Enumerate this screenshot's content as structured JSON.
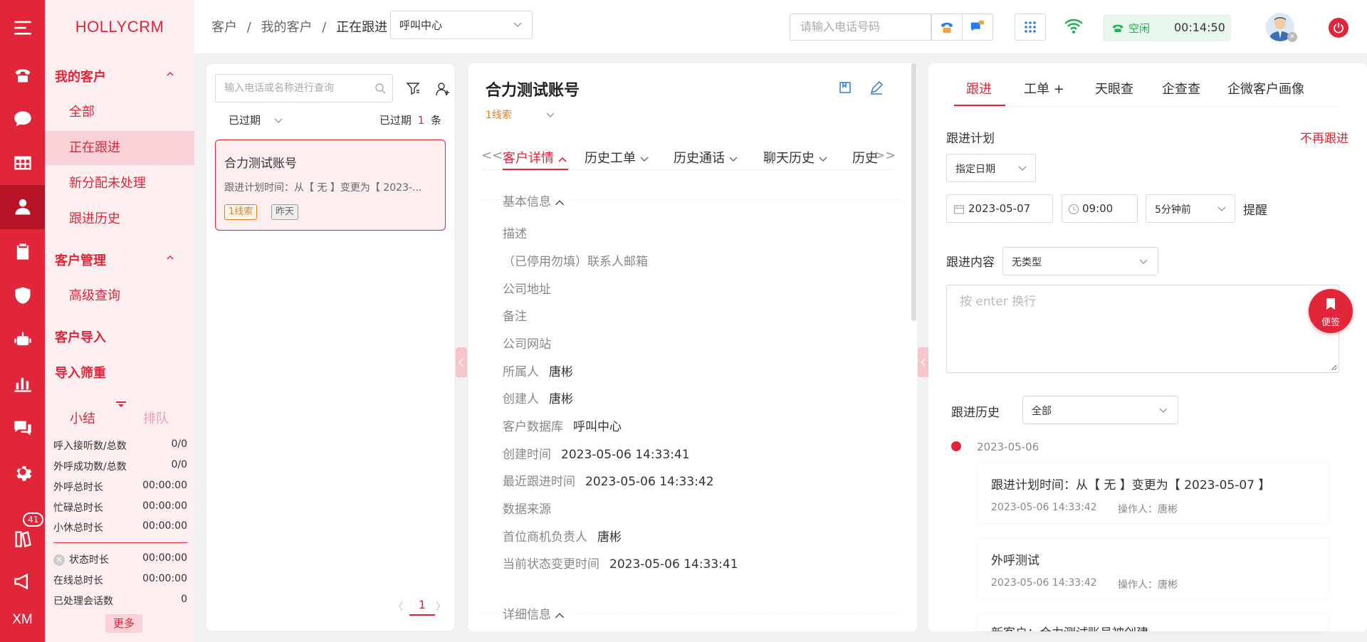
{
  "brand": "HOLLYCRM",
  "rail": {
    "badge_count": "41",
    "xm": "XM"
  },
  "nav": {
    "group1": "我的客户",
    "items1": [
      "全部",
      "正在跟进",
      "新分配未处理",
      "跟进历史"
    ],
    "group2": "客户管理",
    "items2": [
      "高级查询"
    ],
    "group3": "客户导入",
    "group4": "导入筛重"
  },
  "summary": {
    "tab_active": "小结",
    "tab_other": "排队",
    "rows": [
      {
        "label": "呼入接听数/总数",
        "value": "0/0"
      },
      {
        "label": "外呼成功数/总数",
        "value": "0/0"
      },
      {
        "label": "外呼总时长",
        "value": "00:00:00"
      },
      {
        "label": "忙碌总时长",
        "value": "00:00:00"
      },
      {
        "label": "小休总时长",
        "value": "00:00:00"
      }
    ],
    "rows2": [
      {
        "label": "状态时长",
        "value": "00:00:00"
      },
      {
        "label": "在线总时长",
        "value": "00:00:00"
      },
      {
        "label": "已处理会话数",
        "value": "0"
      }
    ],
    "more": "更多"
  },
  "topbar": {
    "crumbs": [
      "客户",
      "我的客户",
      "正在跟进"
    ],
    "sep": "/",
    "channel": "呼叫中心",
    "phone_placeholder": "请输入电话号码",
    "status": "空闲",
    "timer": "00:14:50"
  },
  "list": {
    "search_placeholder": "输入电话或名称进行查询",
    "filter": "已过期",
    "count_prefix": "已过期",
    "count": "1",
    "count_suffix": "条",
    "card_title": "合力测试账号",
    "card_sub": "跟进计划时间：从【 无 】变更为【 2023-...",
    "tag1": "1线索",
    "tag2": "昨天",
    "page": "1"
  },
  "detail": {
    "title": "合力测试账号",
    "lead": "1线索",
    "prev": "<<",
    "next": ">>",
    "tabs": [
      "客户详情",
      "历史工单",
      "历史通话",
      "聊天历史",
      "历史"
    ],
    "section1": "基本信息",
    "fields": [
      {
        "label": "描述",
        "value": ""
      },
      {
        "label": "（已停用勿填）联系人邮箱",
        "value": ""
      },
      {
        "label": "公司地址",
        "value": ""
      },
      {
        "label": "备注",
        "value": ""
      },
      {
        "label": "公司网站",
        "value": ""
      },
      {
        "label": "所属人",
        "value": "唐彬"
      },
      {
        "label": "创建人",
        "value": "唐彬"
      },
      {
        "label": "客户数据库",
        "value": "呼叫中心"
      },
      {
        "label": "创建时间",
        "value": "2023-05-06 14:33:41"
      },
      {
        "label": "最近跟进时间",
        "value": "2023-05-06 14:33:42"
      },
      {
        "label": "数据来源",
        "value": ""
      },
      {
        "label": "首位商机负责人",
        "value": "唐彬"
      },
      {
        "label": "当前状态变更时间",
        "value": "2023-05-06 14:33:41"
      }
    ],
    "section2": "详细信息"
  },
  "right": {
    "tabs": [
      "跟进",
      "工单 +",
      "天眼查",
      "企查查",
      "企微客户画像"
    ],
    "plan_label": "跟进计划",
    "stop": "不再跟进",
    "plan_type": "指定日期",
    "date": "2023-05-07",
    "time": "09:00",
    "remind_before": "5分钟前",
    "remind": "提醒",
    "content_label": "跟进内容",
    "content_type": "无类型",
    "content_placeholder": "按 enter 换行",
    "note_btn": "便签",
    "history_label": "跟进历史",
    "history_filter": "全部",
    "history_date": "2023-05-06",
    "entries": [
      {
        "text": "跟进计划时间：从【 无 】变更为【 2023-05-07 】",
        "time": "2023-05-06 14:33:42",
        "op": "操作人：唐彬"
      },
      {
        "text": "外呼测试",
        "time": "2023-05-06 14:33:42",
        "op": "操作人：唐彬"
      }
    ],
    "entry3_partial": "新客户：合力测试账号被创建"
  }
}
